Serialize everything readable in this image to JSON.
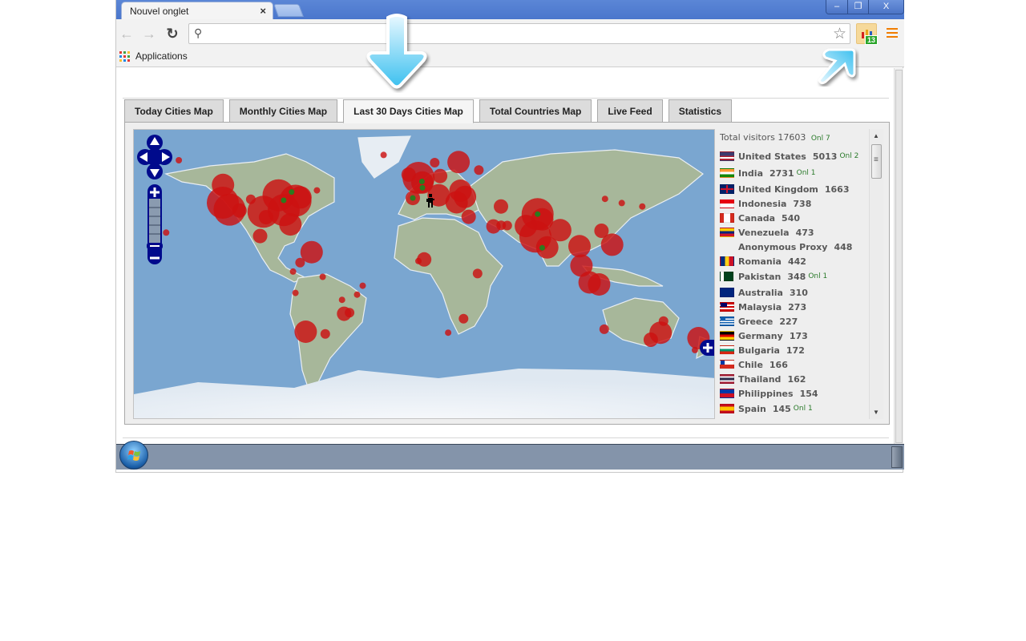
{
  "browser": {
    "tab_title": "Nouvel onglet",
    "tab_close": "×",
    "window_controls": {
      "minimize": "–",
      "restore": "❐",
      "close": "X"
    },
    "nav": {
      "back": "←",
      "forward": "→",
      "reload": "↻"
    },
    "omnibox": {
      "value": "",
      "placeholder": ""
    },
    "extension_badge": "13",
    "bookmarks_bar": {
      "apps_label": "Applications"
    }
  },
  "tabs": [
    {
      "label": "Today Cities Map",
      "active": false
    },
    {
      "label": "Monthly Cities Map",
      "active": false
    },
    {
      "label": "Last 30 Days Cities Map",
      "active": true
    },
    {
      "label": "Total Countries Map",
      "active": false
    },
    {
      "label": "Live Feed",
      "active": false
    },
    {
      "label": "Statistics",
      "active": false
    }
  ],
  "map_controls": {
    "pan_up": "▲",
    "pan_left": "◀",
    "pan_right": "▶",
    "pan_down": "▼",
    "zoom_in": "+",
    "zoom_out": "−",
    "expand": "+"
  },
  "stats": {
    "total_label": "Total visitors",
    "total_value": "17603",
    "total_online": "Onl 7",
    "countries": [
      {
        "name": "United States",
        "visits": "5013",
        "online": "Onl 2",
        "flag": "us"
      },
      {
        "name": "India",
        "visits": "2731",
        "online": "Onl 1",
        "flag": "in"
      },
      {
        "name": "United Kingdom",
        "visits": "1663",
        "online": "",
        "flag": "gb"
      },
      {
        "name": "Indonesia",
        "visits": "738",
        "online": "",
        "flag": "id"
      },
      {
        "name": "Canada",
        "visits": "540",
        "online": "",
        "flag": "ca"
      },
      {
        "name": "Venezuela",
        "visits": "473",
        "online": "",
        "flag": "ve"
      },
      {
        "name": "Anonymous Proxy",
        "visits": "448",
        "online": "",
        "flag": "none"
      },
      {
        "name": "Romania",
        "visits": "442",
        "online": "",
        "flag": "ro"
      },
      {
        "name": "Pakistan",
        "visits": "348",
        "online": "Onl 1",
        "flag": "pk"
      },
      {
        "name": "Australia",
        "visits": "310",
        "online": "",
        "flag": "au"
      },
      {
        "name": "Malaysia",
        "visits": "273",
        "online": "",
        "flag": "my"
      },
      {
        "name": "Greece",
        "visits": "227",
        "online": "",
        "flag": "gr"
      },
      {
        "name": "Germany",
        "visits": "173",
        "online": "",
        "flag": "de"
      },
      {
        "name": "Bulgaria",
        "visits": "172",
        "online": "",
        "flag": "bg"
      },
      {
        "name": "Chile",
        "visits": "166",
        "online": "",
        "flag": "cl"
      },
      {
        "name": "Thailand",
        "visits": "162",
        "online": "",
        "flag": "th"
      },
      {
        "name": "Philippines",
        "visits": "154",
        "online": "",
        "flag": "ph"
      },
      {
        "name": "Spain",
        "visits": "145",
        "online": "Onl 1",
        "flag": "es"
      }
    ]
  },
  "colors": {
    "bubble": "#cc1111",
    "online_dot": "#2d7a1e",
    "map_control": "#000a8c",
    "online_text": "#2a7a2a",
    "title_bar": "#5079cf"
  },
  "map_bubbles": [
    {
      "lon": -122.4,
      "lat": 37.8,
      "size": "xl"
    },
    {
      "lon": -118.2,
      "lat": 34.0,
      "size": "xl"
    },
    {
      "lon": -122.3,
      "lat": 47.6,
      "size": "l"
    },
    {
      "lon": -112.0,
      "lat": 33.5,
      "size": "m"
    },
    {
      "lon": -104.9,
      "lat": 39.7,
      "size": "s"
    },
    {
      "lon": -97.0,
      "lat": 32.8,
      "size": "xl"
    },
    {
      "lon": -87.6,
      "lat": 41.9,
      "size": "xl"
    },
    {
      "lon": -84.4,
      "lat": 33.7,
      "size": "xl"
    },
    {
      "lon": -77.0,
      "lat": 38.9,
      "size": "xl"
    },
    {
      "lon": -73.9,
      "lat": 40.7,
      "size": "l"
    },
    {
      "lon": -80.2,
      "lat": 25.8,
      "size": "l"
    },
    {
      "lon": -95.4,
      "lat": 29.8,
      "size": "m"
    },
    {
      "lon": -79.4,
      "lat": 43.7,
      "size": "xs"
    },
    {
      "lon": -63.6,
      "lat": 44.6,
      "size": "xs"
    },
    {
      "lon": -149.9,
      "lat": 61.2,
      "size": "xs"
    },
    {
      "lon": -157.8,
      "lat": 21.3,
      "size": "xs"
    },
    {
      "lon": -99.1,
      "lat": 19.4,
      "size": "m"
    },
    {
      "lon": -66.9,
      "lat": 10.5,
      "size": "l"
    },
    {
      "lon": -74.1,
      "lat": 4.7,
      "size": "s"
    },
    {
      "lon": -78.5,
      "lat": -0.2,
      "size": "xs"
    },
    {
      "lon": -77.0,
      "lat": -12.0,
      "size": "xs"
    },
    {
      "lon": -70.6,
      "lat": -33.4,
      "size": "l"
    },
    {
      "lon": -58.4,
      "lat": -34.6,
      "size": "s"
    },
    {
      "lon": -46.6,
      "lat": -23.5,
      "size": "m"
    },
    {
      "lon": -43.2,
      "lat": -22.9,
      "size": "s"
    },
    {
      "lon": -38.5,
      "lat": -12.9,
      "size": "xs"
    },
    {
      "lon": -35.0,
      "lat": -8.0,
      "size": "xs"
    },
    {
      "lon": -47.9,
      "lat": -15.8,
      "size": "xs"
    },
    {
      "lon": -60.0,
      "lat": -3.1,
      "size": "xs"
    },
    {
      "lon": -0.1,
      "lat": 51.5,
      "size": "xl"
    },
    {
      "lon": 2.3,
      "lat": 48.9,
      "size": "l"
    },
    {
      "lon": -3.7,
      "lat": 40.4,
      "size": "m"
    },
    {
      "lon": 12.5,
      "lat": 41.9,
      "size": "l"
    },
    {
      "lon": 23.7,
      "lat": 38.0,
      "size": "l"
    },
    {
      "lon": 26.1,
      "lat": 44.4,
      "size": "l"
    },
    {
      "lon": 13.4,
      "lat": 52.5,
      "size": "m"
    },
    {
      "lon": 10.0,
      "lat": 59.9,
      "size": "s"
    },
    {
      "lon": 24.9,
      "lat": 60.2,
      "size": "l"
    },
    {
      "lon": -6.3,
      "lat": 53.3,
      "size": "m"
    },
    {
      "lon": -21.9,
      "lat": 64.1,
      "size": "xs"
    },
    {
      "lon": 28.9,
      "lat": 41.0,
      "size": "l"
    },
    {
      "lon": 37.6,
      "lat": 55.8,
      "size": "s"
    },
    {
      "lon": 31.2,
      "lat": 30.0,
      "size": "m"
    },
    {
      "lon": 3.4,
      "lat": 6.5,
      "size": "m"
    },
    {
      "lon": -0.2,
      "lat": 5.6,
      "size": "xs"
    },
    {
      "lon": 36.8,
      "lat": -1.3,
      "size": "s"
    },
    {
      "lon": 28.0,
      "lat": -26.2,
      "size": "s"
    },
    {
      "lon": 18.4,
      "lat": -33.9,
      "size": "xs"
    },
    {
      "lon": 51.5,
      "lat": 25.3,
      "size": "s"
    },
    {
      "lon": 55.3,
      "lat": 25.2,
      "size": "s"
    },
    {
      "lon": 46.7,
      "lat": 24.7,
      "size": "m"
    },
    {
      "lon": 51.4,
      "lat": 35.7,
      "size": "m"
    },
    {
      "lon": 67.0,
      "lat": 24.9,
      "size": "l"
    },
    {
      "lon": 74.3,
      "lat": 31.5,
      "size": "xl"
    },
    {
      "lon": 77.2,
      "lat": 28.6,
      "size": "l"
    },
    {
      "lon": 72.9,
      "lat": 19.1,
      "size": "xl"
    },
    {
      "lon": 80.3,
      "lat": 13.1,
      "size": "l"
    },
    {
      "lon": 88.4,
      "lat": 22.6,
      "size": "l"
    },
    {
      "lon": 100.5,
      "lat": 13.8,
      "size": "l"
    },
    {
      "lon": 101.7,
      "lat": 3.1,
      "size": "l"
    },
    {
      "lon": 106.8,
      "lat": -6.2,
      "size": "l"
    },
    {
      "lon": 112.7,
      "lat": -7.3,
      "size": "l"
    },
    {
      "lon": 120.9,
      "lat": 14.6,
      "size": "l"
    },
    {
      "lon": 114.2,
      "lat": 22.3,
      "size": "m"
    },
    {
      "lon": 116.4,
      "lat": 39.9,
      "size": "xs"
    },
    {
      "lon": 126.9,
      "lat": 37.6,
      "size": "xs"
    },
    {
      "lon": 139.7,
      "lat": 35.7,
      "size": "xs"
    },
    {
      "lon": 151.2,
      "lat": -33.9,
      "size": "l"
    },
    {
      "lon": 145.0,
      "lat": -37.8,
      "size": "m"
    },
    {
      "lon": 153.0,
      "lat": -27.5,
      "size": "s"
    },
    {
      "lon": 115.9,
      "lat": -32.0,
      "size": "s"
    },
    {
      "lon": 174.8,
      "lat": -36.9,
      "size": "l"
    },
    {
      "lon": 172.6,
      "lat": -43.5,
      "size": "xs"
    }
  ],
  "online_dots": [
    {
      "lon": -79.4,
      "lat": 43.7
    },
    {
      "lon": -84.4,
      "lat": 39.1
    },
    {
      "lon": 74.3,
      "lat": 31.5
    },
    {
      "lon": 77.2,
      "lat": 12.9
    },
    {
      "lon": -3.7,
      "lat": 40.4
    },
    {
      "lon": 2.0,
      "lat": 49.5
    },
    {
      "lon": 2.3,
      "lat": 46.0
    }
  ]
}
